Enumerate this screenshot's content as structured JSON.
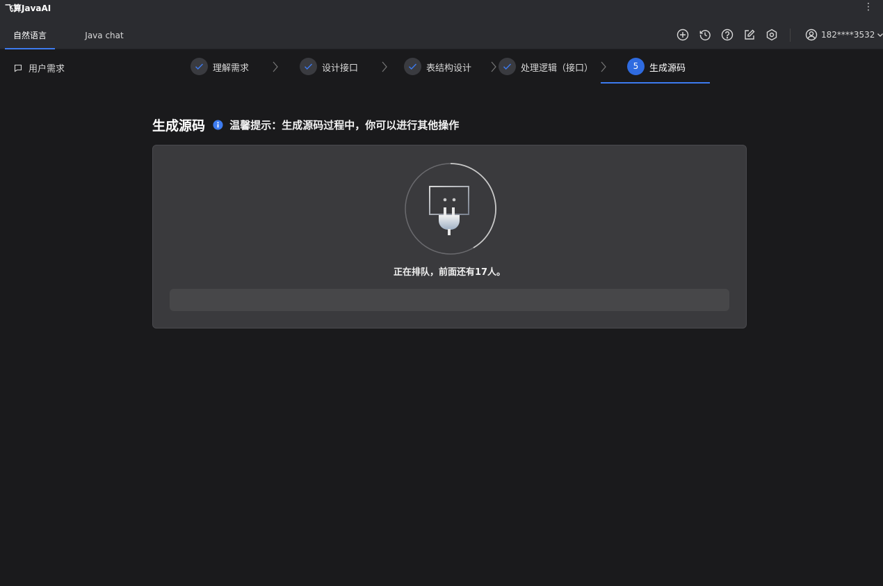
{
  "app": {
    "title": "飞算JavaAI"
  },
  "tabs": [
    {
      "label": "自然语言",
      "active": true
    },
    {
      "label": "Java chat",
      "active": false
    }
  ],
  "toolbar": {
    "icons": [
      "add-icon",
      "history-icon",
      "help-icon",
      "edit-icon",
      "settings-icon"
    ]
  },
  "user": {
    "name": "182****3532"
  },
  "requirement_link": {
    "label": "用户需求"
  },
  "steps": [
    {
      "label": "理解需求",
      "status": "done"
    },
    {
      "label": "设计接口",
      "status": "done"
    },
    {
      "label": "表结构设计",
      "status": "done"
    },
    {
      "label": "处理逻辑（接口）",
      "status": "done"
    },
    {
      "number": "5",
      "label": "生成源码",
      "status": "active"
    }
  ],
  "main": {
    "title": "生成源码",
    "tip": "温馨提示：生成源码过程中，你可以进行其他操作",
    "queue_message": "正在排队，前面还有17人。",
    "progress": 0
  },
  "colors": {
    "accent": "#3d7bf0",
    "background": "#1a1a1c",
    "card": "#3a3a3d"
  }
}
